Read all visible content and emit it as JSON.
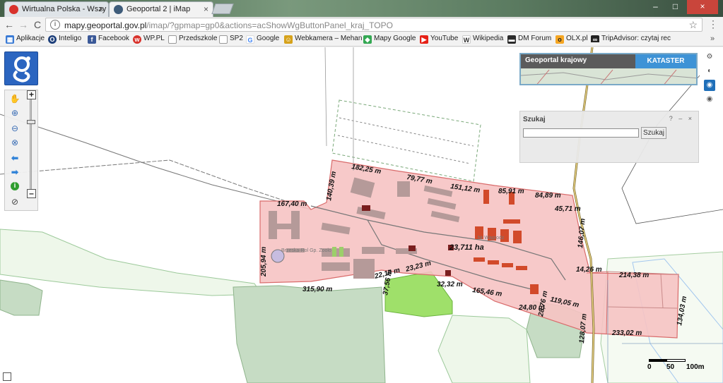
{
  "browser": {
    "tabs": [
      {
        "title": "Wirtualna Polska - Wszy",
        "close": "×",
        "icon_color": "#d8322b"
      },
      {
        "title": "Geoportal 2 | iMap",
        "close": "×",
        "icon_color": "#3f5c7a"
      }
    ],
    "window_controls": [
      "–",
      "□",
      "×"
    ],
    "nav": {
      "back": "←",
      "forward": "→",
      "reload": "C"
    },
    "address": {
      "host": "mapy.geoportal.gov.pl",
      "path": "/imap/?gpmap=gp0&actions=acShowWgButtonPanel_kraj_TOPO",
      "info_icon": "i",
      "star": "☆"
    },
    "menu": "⋮",
    "bookmarks": [
      {
        "label": "Aplikacje",
        "color": "#3a7bd5"
      },
      {
        "label": "Inteligo",
        "color": "#1d3f7a"
      },
      {
        "label": "Facebook",
        "color": "#3b5998"
      },
      {
        "label": "WP.PL",
        "color": "#d8322b"
      },
      {
        "label": "Przedszkole",
        "color": "#8a8a8a"
      },
      {
        "label": "SP2",
        "color": "#8a8a8a"
      },
      {
        "label": "Google",
        "color": "#4285f4"
      },
      {
        "label": "Webkamera – Mehan",
        "color": "#d6a21b"
      },
      {
        "label": "Mapy Google",
        "color": "#34a853"
      },
      {
        "label": "YouTube",
        "color": "#e62117"
      },
      {
        "label": "Wikipedia",
        "color": "#555555"
      },
      {
        "label": "DM Forum",
        "color": "#2b2b2b"
      },
      {
        "label": "OLX.pl",
        "color": "#f5a623"
      },
      {
        "label": "TripAdvisor: czytaj rec",
        "color": "#222222"
      }
    ],
    "bookmarks_more": "»"
  },
  "map": {
    "minimap": {
      "left_label": "Geoportal krajowy",
      "right_label": "KATASTER"
    },
    "search": {
      "title": "Szukaj",
      "controls": "? – ×",
      "value": "",
      "button": "Szukaj"
    },
    "zoom": {
      "plus": "+",
      "minus": "–",
      "level_fraction": 0.23
    },
    "dimension_labels": [
      "182,25 m",
      "79,77 m",
      "151,12 m",
      "85,91 m",
      "84,89 m",
      "45,71 m",
      "167,40 m",
      "140,39 m",
      "205,94 m",
      "315,90 m",
      "22,14 m",
      "23,23 m",
      "37,56 m",
      "32,32 m",
      "165,46 m",
      "119,05 m",
      "14,26 m",
      "214,38 m",
      "134,03 m",
      "233,02 m",
      "128,07 m",
      "146,07 m",
      "24,80 m",
      "28,76 m"
    ],
    "area_label": "23,711 ha",
    "place_labels": [
      "Brzeska-Rol Gp. Zoolo",
      "Nr Wągrodz"
    ],
    "scale": {
      "labels": [
        "0",
        "50",
        "100m"
      ]
    },
    "colors": {
      "parcel_fill": "#f6c3c3",
      "parcel_stroke": "#d96b6b",
      "building": "#b59a99",
      "red_building": "#d24a2a",
      "forest": "#c6dcc4",
      "meadow": "#9fe06a",
      "background": "#ffffff"
    }
  }
}
